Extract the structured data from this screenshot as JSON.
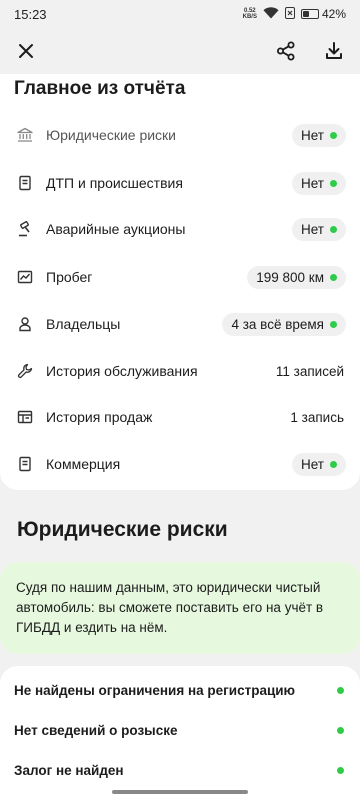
{
  "status": {
    "time": "15:23",
    "speed_value": "0.52",
    "speed_unit": "KB/S",
    "battery": "42"
  },
  "summary": {
    "title": "Главное из отчёта",
    "rows": [
      {
        "label": "Юридические риски",
        "value": "Нет",
        "icon": "bank-icon"
      },
      {
        "label": "ДТП и происшествия",
        "value": "Нет",
        "icon": "document-icon"
      },
      {
        "label": "Аварийные аукционы",
        "value": "Нет",
        "icon": "auction-gavel-icon"
      },
      {
        "label": "Пробег",
        "value": "199 800 км",
        "icon": "mileage-chart-icon"
      },
      {
        "label": "Владельцы",
        "value": "4 за всё время",
        "icon": "person-icon"
      },
      {
        "label": "История обслуживания",
        "value": "11 записей",
        "icon": "wrench-icon"
      },
      {
        "label": "История продаж",
        "value": "1 запись",
        "icon": "sales-history-icon"
      },
      {
        "label": "Коммерция",
        "value": "Нет",
        "icon": "commerce-doc-icon"
      }
    ]
  },
  "legal": {
    "title": "Юридические риски",
    "info_text": "Судя по нашим данным, это юридически чистый автомобиль: вы сможете поставить его на учёт в ГИБДД и ездить на нём.",
    "checks": [
      {
        "label": "Не найдены ограничения на регистрацию"
      },
      {
        "label": "Нет сведений о розыске"
      },
      {
        "label": "Залог не найден"
      }
    ]
  },
  "colors": {
    "ok_dot": "#2ecc49",
    "info_bg": "#e6f8de",
    "page_bg": "#f1f1f1"
  }
}
